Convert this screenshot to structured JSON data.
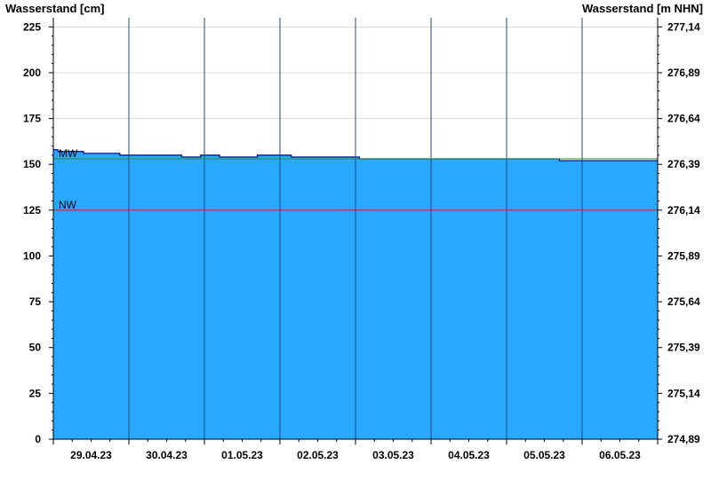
{
  "chart_data": {
    "type": "area",
    "y_left_label": "Wasserstand [cm]",
    "y_right_label": "Wasserstand [m NHN]",
    "ylim": [
      0,
      230
    ],
    "y_left_ticks": [
      "0",
      "25",
      "50",
      "75",
      "100",
      "125",
      "150",
      "175",
      "200",
      "225"
    ],
    "y_right_ticks": [
      "274,89",
      "275,14",
      "275,39",
      "275,64",
      "275,89",
      "276,14",
      "276,39",
      "276,64",
      "276,89",
      "277,14"
    ],
    "x_range_days": [
      0,
      8
    ],
    "date_labels": [
      "29.04.23",
      "30.04.23",
      "01.05.23",
      "02.05.23",
      "03.05.23",
      "04.05.23",
      "05.05.23",
      "06.05.23"
    ],
    "grid": true,
    "series": [
      {
        "x": [
          0,
          0.06,
          0.06,
          0.4,
          0.4,
          0.88,
          0.88,
          1.7,
          1.7,
          1.95,
          1.95,
          2.2,
          2.2,
          2.7,
          2.7,
          3.15,
          3.15,
          4.05,
          4.05,
          6.7,
          6.7,
          8
        ],
        "y": [
          158,
          158,
          157,
          157,
          156,
          156,
          155,
          155,
          154,
          154,
          155,
          155,
          154,
          154,
          155,
          155,
          154,
          154,
          153,
          153,
          152,
          152
        ]
      }
    ],
    "reference_lines": [
      {
        "label": "MW",
        "value": 153,
        "color": "#2e8b2e"
      },
      {
        "label": "NW",
        "value": 125,
        "color": "#cc2222"
      }
    ],
    "colors": {
      "fill": "#29a8ff",
      "outline": "#00007a",
      "grid": "#d8d8d8"
    }
  }
}
